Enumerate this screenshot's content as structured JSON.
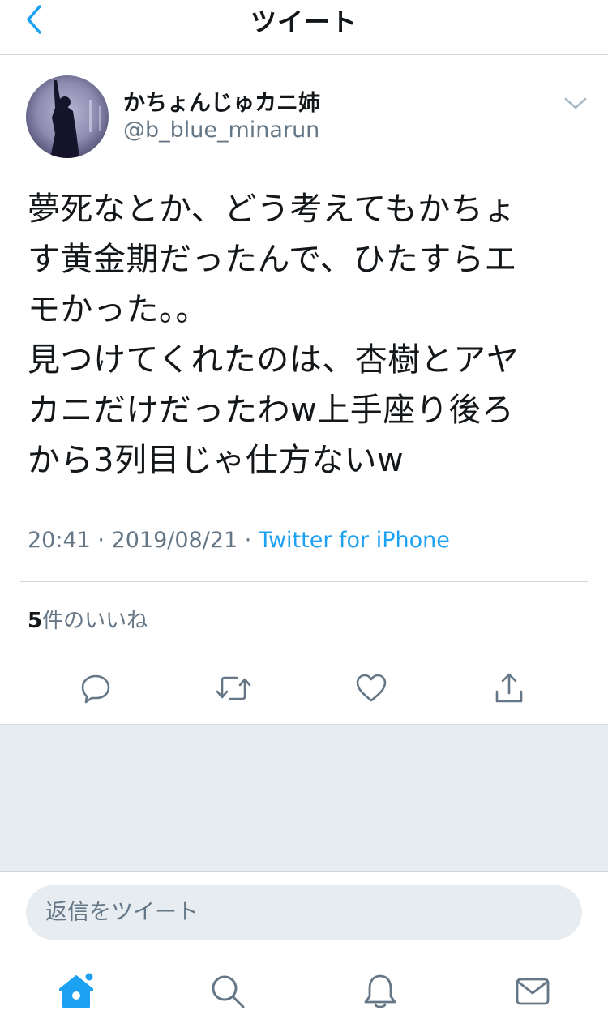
{
  "navbar": {
    "title": "ツイート",
    "back_icon": "chevron-left-icon"
  },
  "tweet": {
    "author": {
      "display_name": "かちょんじゅカニ姉",
      "handle": "@b_blue_minarun"
    },
    "text_lines": [
      "夢死なとか、どう考えてもかちょ",
      "す黄金期だったんで、ひたすらエ",
      "モかった。。",
      "見つけてくれたのは、杏樹とアヤ",
      "カニだけだったわw上手座り後ろ",
      "から3列目じゃ仕方ないw"
    ],
    "timestamp": "20:41 · 2019/08/21 · ",
    "source": "Twitter for iPhone",
    "likes": {
      "count": "5",
      "label": "件のいいね"
    }
  },
  "actions": {
    "reply_icon": "reply-icon",
    "retweet_icon": "retweet-icon",
    "like_icon": "heart-icon",
    "share_icon": "share-icon"
  },
  "reply_bar": {
    "placeholder": "返信をツイート"
  },
  "tabbar": {
    "items": [
      "home-icon",
      "search-icon",
      "notifications-icon",
      "messages-icon"
    ],
    "accent": "#1da1f2"
  },
  "colors": {
    "accent": "#1da1f2",
    "secondary_text": "#657786",
    "divider": "#cfd5da",
    "background_gray": "#e6ecf0"
  }
}
